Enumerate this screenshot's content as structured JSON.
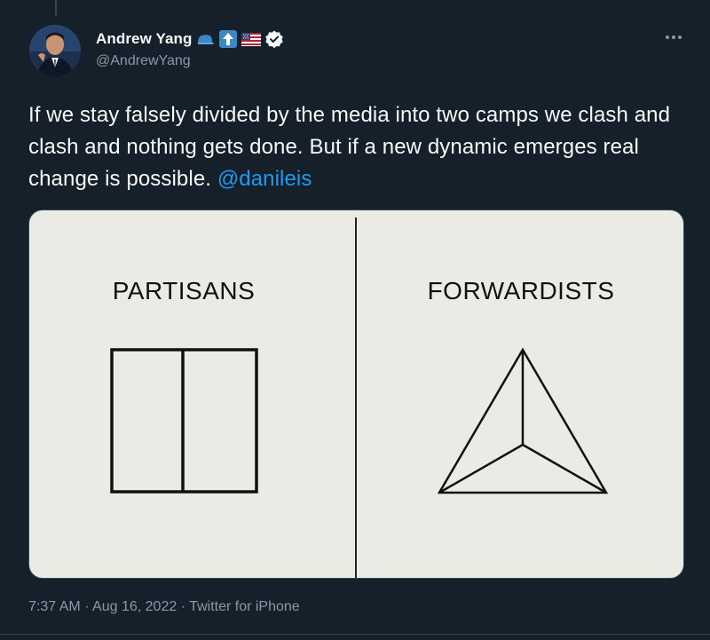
{
  "author": {
    "display_name": "Andrew Yang",
    "handle": "@AndrewYang",
    "badges": [
      "blue-cap-emoji",
      "up-arrow-emoji",
      "us-flag-emoji",
      "verified-badge-icon"
    ]
  },
  "tweet": {
    "text": "If we stay falsely divided by the media into two camps we clash and clash and nothing gets done. But if a new dynamic emerges real change is possible.",
    "mention": "@danileis"
  },
  "media": {
    "left_label": "PARTISANS",
    "right_label": "FORWARDISTS"
  },
  "meta": {
    "time": "7:37 AM",
    "separator": "·",
    "date": "Aug 16, 2022",
    "source": "Twitter for iPhone"
  },
  "colors": {
    "background": "#15202b",
    "text_primary": "#f7f9f9",
    "text_secondary": "#8b98a5",
    "link": "#1d9bf0",
    "verified": "#ffffff",
    "image_background": "#ebebe6"
  },
  "icons": {
    "more": "more-icon"
  }
}
